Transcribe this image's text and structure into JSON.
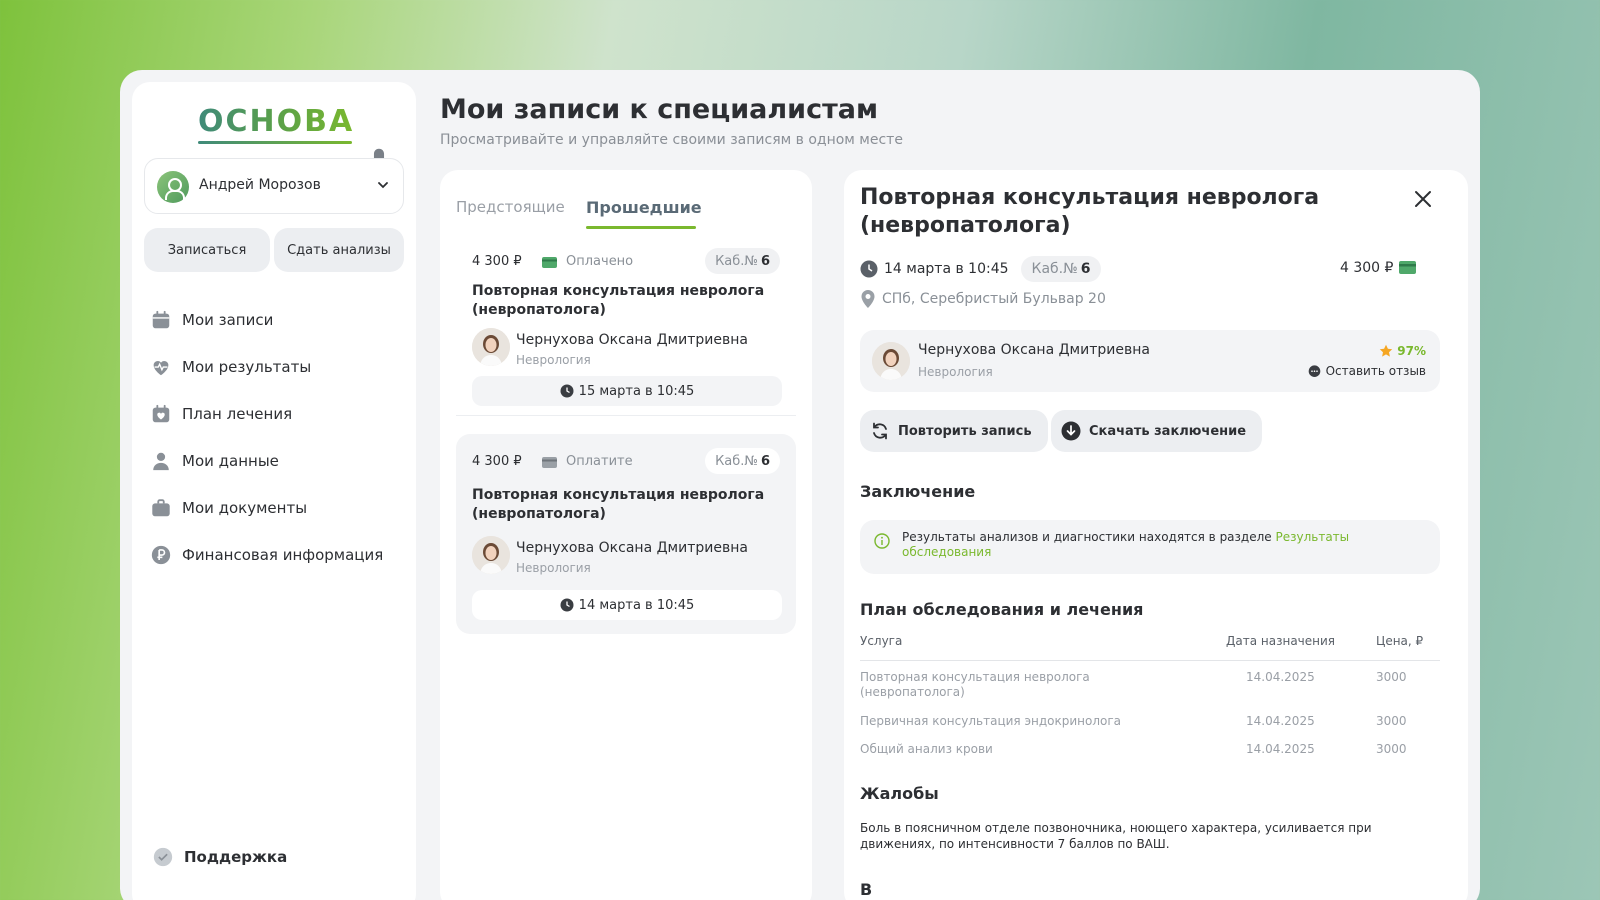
{
  "brand": {
    "logo": "ОСНОВА"
  },
  "user": {
    "name": "Андрей Морозов"
  },
  "actions": {
    "book": "Записаться",
    "tests": "Сдать анализы"
  },
  "nav": [
    {
      "label": "Мои записи",
      "icon": "calendar-icon"
    },
    {
      "label": "Мои результаты",
      "icon": "heart-pulse-icon"
    },
    {
      "label": "План лечения",
      "icon": "calendar-heart-icon"
    },
    {
      "label": "Мои данные",
      "icon": "person-icon"
    },
    {
      "label": "Мои документы",
      "icon": "briefcase-icon"
    },
    {
      "label": "Финансовая информация",
      "icon": "ruble-icon"
    }
  ],
  "support": {
    "label": "Поддержка"
  },
  "header": {
    "title": "Мои записи к специалистам",
    "subtitle": "Просматривайте и управляйте своими записям в одном месте"
  },
  "tabs": {
    "upcoming": "Предстоящие",
    "past": "Прошедшие",
    "active": "past"
  },
  "appointments": [
    {
      "price": "4 300 ₽",
      "status": "Оплачено",
      "cab_label": "Каб.№",
      "cab_num": "6",
      "service": "Повторная консультация невролога (невропатолога)",
      "doctor": "Чернухова Оксана Дмитриевна",
      "specialty": "Неврология",
      "date": "15 марта в 10:45"
    },
    {
      "price": "4 300 ₽",
      "status": "Оплатите",
      "cab_label": "Каб.№",
      "cab_num": "6",
      "service": "Повторная консультация невролога (невропатолога)",
      "doctor": "Чернухова Оксана Дмитриевна",
      "specialty": "Неврология",
      "date": "14 марта в 10:45"
    }
  ],
  "detail": {
    "title": "Повторная консультация невролога (невропатолога)",
    "date": "14 марта в 10:45",
    "cab_label": "Каб.№",
    "cab_num": "6",
    "price": "4 300",
    "address": "СПб, Серебристый Бульвар 20",
    "doctor": "Чернухова Оксана Дмитриевна",
    "specialty": "Неврология",
    "rating": "97%",
    "review": "Оставить отзыв",
    "repeat": "Повторить запись",
    "download": "Скачать заключение",
    "conclusion_heading": "Заключение",
    "conclusion_text": "Результаты анализов и диагностики находятся в разделе",
    "conclusion_link": "Результаты обследования",
    "plan_heading": "План обследования и лечения",
    "plan_columns": {
      "service": "Услуга",
      "date": "Дата назначения",
      "price": "Цена, ₽"
    },
    "plan_rows": [
      {
        "service": "Повторная консультация невролога (невропатолога)",
        "date": "14.04.2025",
        "price": "3000"
      },
      {
        "service": "Первичная консультация эндокринолога",
        "date": "14.04.2025",
        "price": "3000"
      },
      {
        "service": "Общий анализ крови",
        "date": "14.04.2025",
        "price": "3000"
      }
    ],
    "complaints_heading": "Жалобы",
    "complaints_text": "Боль в поясничном отделе позвоночника, ноющего характера, усиливается при движениях, по интенсивности 7 баллов по ВАШ.",
    "next_heading": "В"
  },
  "colors": {
    "accent": "#7ab82e",
    "brand_teal": "#3f8a7a",
    "star": "#f5a623",
    "card_paid": "#4fa86a"
  }
}
